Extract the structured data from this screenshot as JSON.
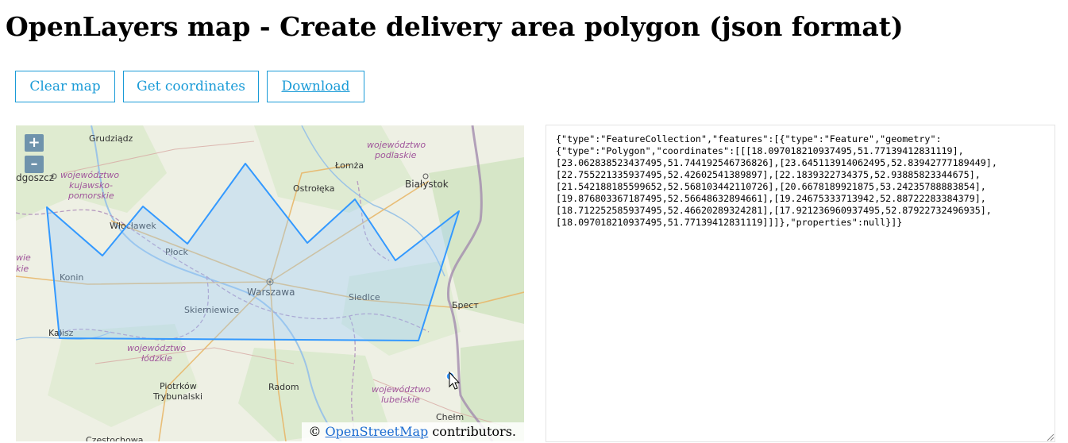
{
  "page": {
    "title": "OpenLayers map - Create delivery area polygon (json format)"
  },
  "toolbar": {
    "clear_label": "Clear map",
    "get_label": "Get coordinates",
    "download_label": "Download"
  },
  "map": {
    "zoom_in": "+",
    "zoom_out": "–",
    "attribution_prefix": "©",
    "attribution_link": "OpenStreetMap",
    "attribution_suffix": "contributors.",
    "places": {
      "grudziadz": "Grudziądz",
      "bydgoszcz": "dgoszcz",
      "lomza": "Łomża",
      "ostroleka": "Ostrołęka",
      "bialystok": "Białystok",
      "wloclawek": "Włocławek",
      "plock": "Płock",
      "konin": "Konin",
      "warszawa": "Warszawa",
      "siedlce": "Siedlce",
      "brest": "Брест",
      "skierniewice": "Skierniewice",
      "kalisz": "Kalisz",
      "piotrkow": "Piotrków",
      "trybunalski": "Trybunalski",
      "radom": "Radom",
      "chelm": "Chełm",
      "czestochowa": "Częstochowa"
    },
    "regions": {
      "podlaskie_1": "województwo",
      "podlaskie_2": "podlaskie",
      "kujawsko_1": "województwo",
      "kujawsko_2": "kujawsko-",
      "kujawsko_3": "pomorskie",
      "wie": "wie",
      "kie": "kie",
      "lodzkie_1": "województwo",
      "lodzkie_2": "łódzkie",
      "lubelskie_1": "województwo",
      "lubelskie_2": "lubelskie"
    }
  },
  "output": {
    "text": "{\"type\":\"FeatureCollection\",\"features\":[{\"type\":\"Feature\",\"geometry\":\n{\"type\":\"Polygon\",\"coordinates\":[[[18.097018210937495,51.77139412831119],\n[23.062838523437495,51.744192546736826],[23.645113914062495,52.83942777189449],\n[22.755221335937495,52.42602541389897],[22.1839322734375,52.93885823344675],\n[21.542188185599652,52.568103442110726],[20.6678189921875,53.24235788883854],\n[19.876803367187495,52.56648632894661],[19.24675333713942,52.88722283384379],\n[18.712252585937495,52.46620289324281],[17.921236960937495,52.87922732496935],\n[18.097018210937495,51.77139412831119]]]},\"properties\":null}]}"
  },
  "colors": {
    "accent": "#1a9bd7",
    "polygon_stroke": "#3399ff",
    "polygon_fill": "rgba(153,204,255,0.35)",
    "map_bg": "#eef0e4",
    "border": "#a38cae"
  }
}
